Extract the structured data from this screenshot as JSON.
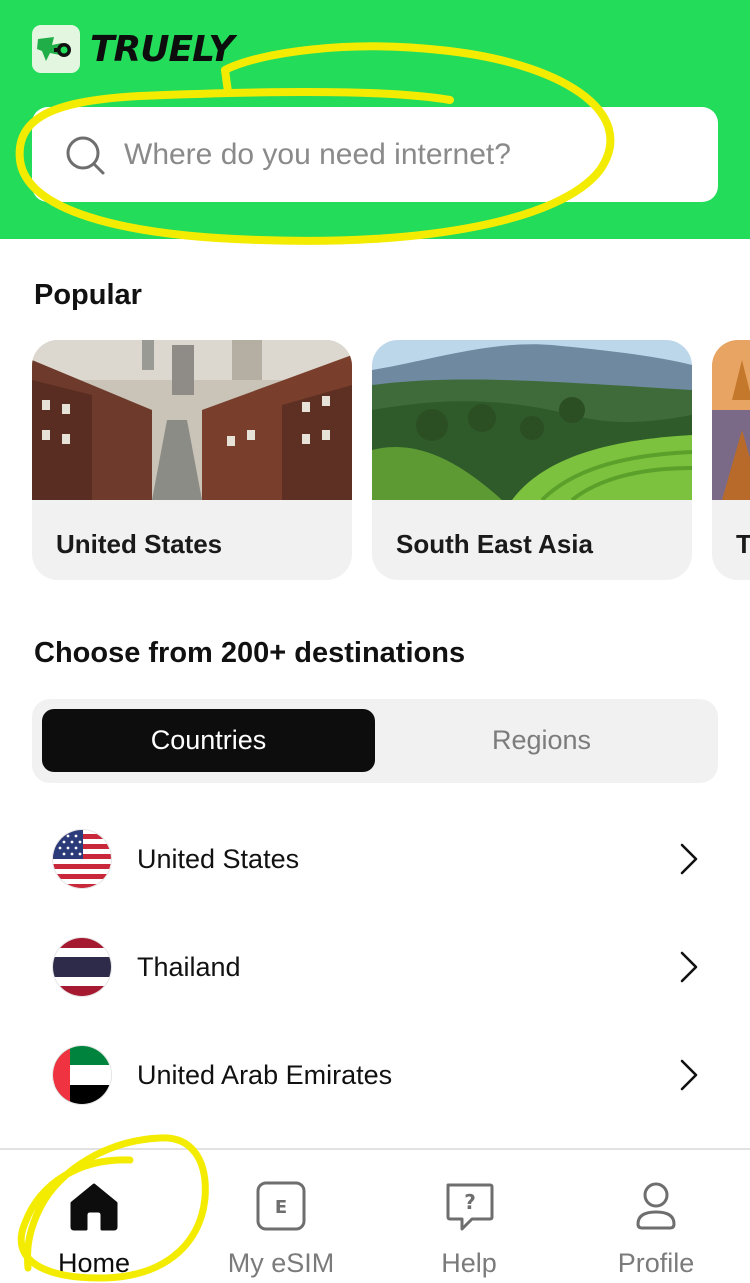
{
  "app": {
    "name": "TRUELY"
  },
  "search": {
    "placeholder": "Where do you need internet?"
  },
  "popular": {
    "title": "Popular",
    "cards": [
      {
        "label": "United States"
      },
      {
        "label": "South East Asia"
      },
      {
        "label": "T"
      }
    ]
  },
  "destinations": {
    "title": "Choose from 200+ destinations",
    "segments": {
      "active": "Countries",
      "inactive": "Regions"
    },
    "items": [
      {
        "label": "United States",
        "flag": "us-flag-icon"
      },
      {
        "label": "Thailand",
        "flag": "thailand-flag-icon"
      },
      {
        "label": "United Arab Emirates",
        "flag": "uae-flag-icon"
      }
    ]
  },
  "tabbar": {
    "tabs": [
      {
        "label": "Home",
        "icon": "home-icon",
        "active": true
      },
      {
        "label": "My eSIM",
        "icon": "esim-icon",
        "active": false
      },
      {
        "label": "Help",
        "icon": "help-icon",
        "active": false
      },
      {
        "label": "Profile",
        "icon": "profile-icon",
        "active": false
      }
    ]
  },
  "colors": {
    "brand": "#22dc5a",
    "annotation": "#f4ec00",
    "active": "#0d0d0d"
  }
}
